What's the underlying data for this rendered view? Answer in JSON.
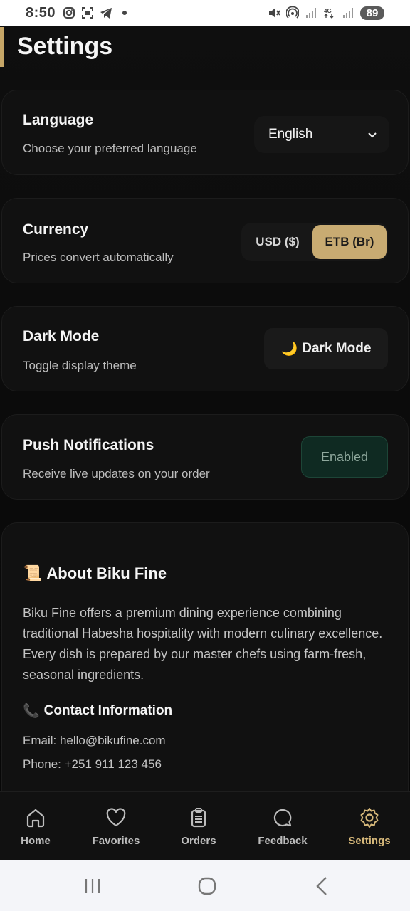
{
  "status_bar": {
    "time": "8:50",
    "battery": "89",
    "left_icons": [
      "instagram-icon",
      "screenshot-icon",
      "telegram-icon",
      "dot-icon"
    ],
    "right_icons": [
      "mute-icon",
      "hotspot-icon",
      "signal-icon",
      "4g-icon",
      "signal-icon"
    ]
  },
  "header": {
    "title": "Settings",
    "accent_color": "#c6a667"
  },
  "language": {
    "title": "Language",
    "subtitle": "Choose your preferred language",
    "selected": "English"
  },
  "currency": {
    "title": "Currency",
    "subtitle": "Prices convert automatically",
    "options": [
      "USD ($)",
      "ETB (Br)"
    ],
    "selected": "ETB (Br)"
  },
  "dark_mode": {
    "title": "Dark Mode",
    "subtitle": "Toggle display theme",
    "button_label": "Dark Mode",
    "icon": "🌙"
  },
  "notifications": {
    "title": "Push Notifications",
    "subtitle": "Receive live updates on your order",
    "button_label": "Enabled"
  },
  "about": {
    "icon": "📜",
    "title": "About Biku Fine",
    "body": "Biku Fine offers a premium dining experience combining traditional Habesha hospitality with modern culinary excellence. Every dish is prepared by our master chefs using farm-fresh, seasonal ingredients.",
    "contact_icon": "📞",
    "contact_title": "Contact Information",
    "email": "Email: hello@bikufine.com",
    "phone": "Phone: +251 911 123 456"
  },
  "bottom_nav": {
    "items": [
      {
        "label": "Home",
        "icon": "home-icon"
      },
      {
        "label": "Favorites",
        "icon": "heart-icon"
      },
      {
        "label": "Orders",
        "icon": "clipboard-icon"
      },
      {
        "label": "Feedback",
        "icon": "chat-icon"
      },
      {
        "label": "Settings",
        "icon": "gear-icon"
      }
    ],
    "active": "Settings",
    "active_color": "#d6b87a"
  },
  "system_nav": [
    "recents-icon",
    "home-circle-icon",
    "back-icon"
  ]
}
